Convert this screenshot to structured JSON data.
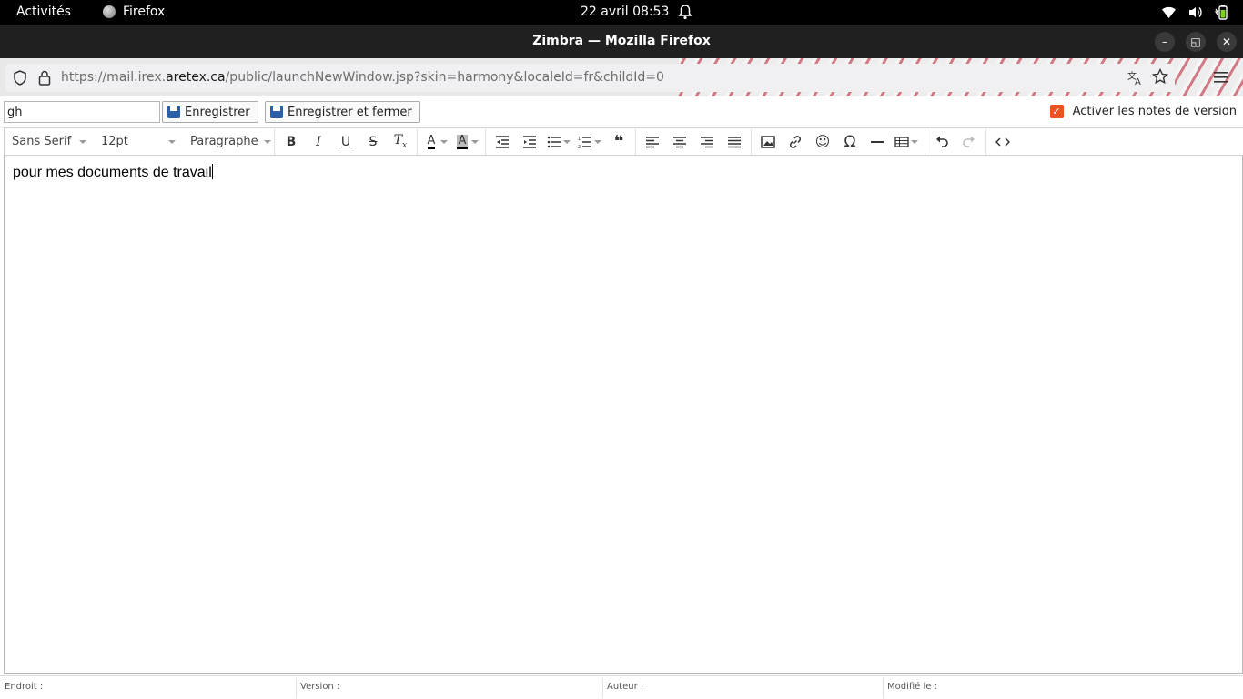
{
  "gnome": {
    "activities": "Activités",
    "app_name": "Firefox",
    "clock": "22 avril  08:53"
  },
  "window": {
    "title": "Zimbra — Mozilla Firefox"
  },
  "urlbar": {
    "url_prefix": "https://mail.irex.",
    "url_domain": "aretex.ca",
    "url_suffix": "/public/launchNewWindow.jsp?skin=harmony&localeId=fr&childId=0"
  },
  "doc": {
    "name_value": "gh",
    "save_label": "Enregistrer",
    "save_close_label": "Enregistrer et fermer",
    "version_notes_label": "Activer les notes de version",
    "version_notes_checked": true
  },
  "editor_toolbar": {
    "font_family": "Sans Serif",
    "font_size": "12pt",
    "block_format": "Paragraphe"
  },
  "editor": {
    "content": "pour mes documents de travail"
  },
  "footer": {
    "location_label": "Endroit :",
    "version_label": "Version :",
    "author_label": "Auteur :",
    "modified_label": "Modifié le :"
  },
  "colors": {
    "checkbox_accent": "#e95420",
    "save_icon": "#2b5fa8"
  }
}
